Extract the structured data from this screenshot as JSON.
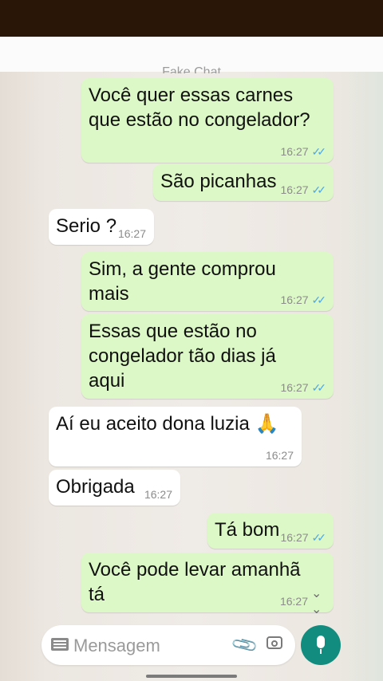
{
  "header": {
    "title": "Fake Chat"
  },
  "messages": [
    {
      "text": "Você quer essas carnes\nque estão no congelador?",
      "time": "16:27",
      "dir": "out"
    },
    {
      "text": "São picanhas",
      "time": "16:27",
      "dir": "out"
    },
    {
      "text": "Serio ?",
      "time": "16:27",
      "dir": "in"
    },
    {
      "text": "Sim, a gente comprou\nmais",
      "time": "16:27",
      "dir": "out"
    },
    {
      "text": "Essas que estão no\ncongelador tão dias já\naqui",
      "time": "16:27",
      "dir": "out"
    },
    {
      "text": "Aí eu aceito dona luzia 🙏",
      "time": "16:27",
      "dir": "in"
    },
    {
      "text": "Obrigada",
      "time": "16:27",
      "dir": "in"
    },
    {
      "text": "Tá bom",
      "time": "16:27",
      "dir": "out"
    },
    {
      "text": "Você pode levar amanhã\ntá",
      "time": "16:27",
      "dir": "out"
    }
  ],
  "composer": {
    "placeholder": "Mensagem"
  },
  "icons": {
    "keyboard": "keyboard-icon",
    "attach": "paperclip-icon",
    "camera": "camera-icon",
    "mic": "mic-icon",
    "scroll": "double-chevron-down-icon"
  },
  "colors": {
    "outgoing_bubble": "#dcf8c6",
    "incoming_bubble": "#ffffff",
    "mic_button": "#128c7e",
    "read_tick": "#4fa9e8"
  }
}
